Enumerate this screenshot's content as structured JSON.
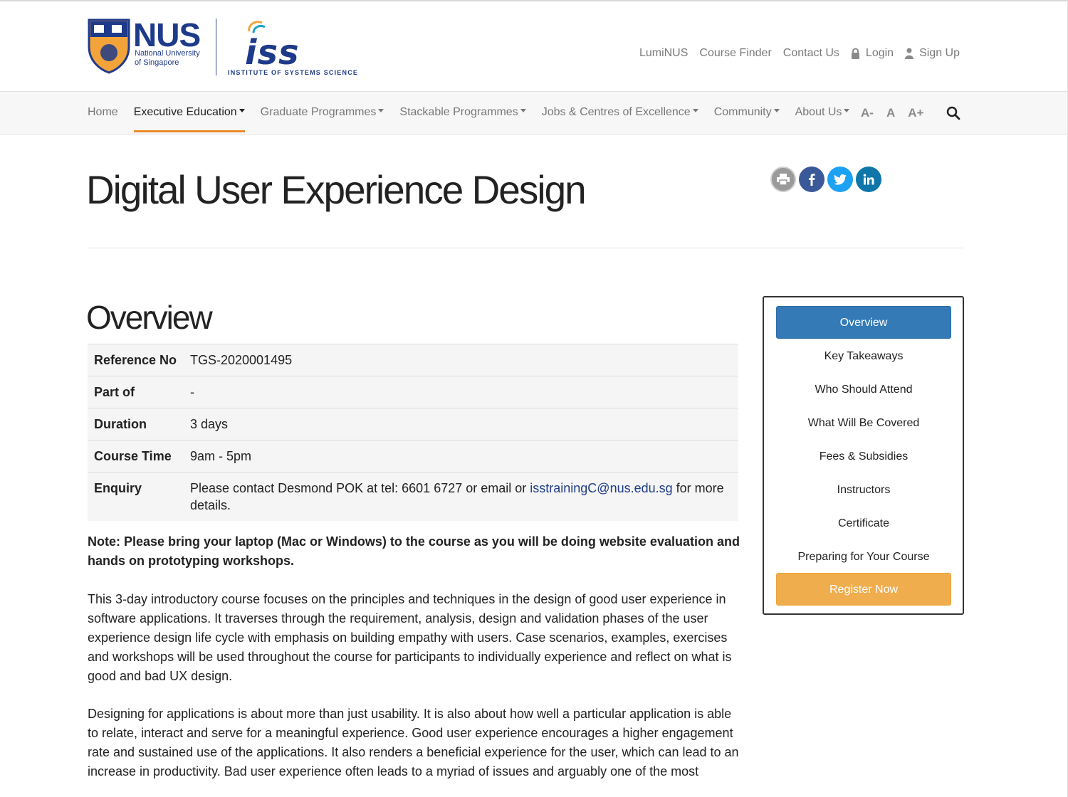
{
  "header": {
    "nus_logo_text": "NUS",
    "nus_logo_sub1": "National University",
    "nus_logo_sub2": "of Singapore",
    "iss_logo_text": "iss",
    "iss_logo_sub": "INSTITUTE OF SYSTEMS SCIENCE",
    "utility_links": [
      "LumiNUS",
      "Course Finder",
      "Contact Us"
    ],
    "login_label": "Login",
    "signup_label": "Sign Up"
  },
  "nav": {
    "items": [
      {
        "label": "Home",
        "dropdown": false
      },
      {
        "label": "Executive Education",
        "dropdown": true,
        "active": true
      },
      {
        "label": "Graduate Programmes",
        "dropdown": true
      },
      {
        "label": "Stackable Programmes",
        "dropdown": true
      },
      {
        "label": "Jobs & Centres of Excellence",
        "dropdown": true
      },
      {
        "label": "Community",
        "dropdown": true
      },
      {
        "label": "About Us",
        "dropdown": true
      }
    ],
    "font_sizes": [
      "A-",
      "A",
      "A+"
    ],
    "accent_color": "#e98b2b"
  },
  "page": {
    "title": "Digital User Experience Design"
  },
  "overview": {
    "heading": "Overview",
    "table": [
      {
        "key": "Reference No",
        "value": "TGS-2020001495"
      },
      {
        "key": "Part of",
        "value": "-"
      },
      {
        "key": "Duration",
        "value": "3 days"
      },
      {
        "key": "Course Time",
        "value": "9am - 5pm"
      }
    ],
    "enquiry_key": "Enquiry",
    "enquiry_prefix": "Please contact Desmond POK at tel: 6601 6727 or email or ",
    "enquiry_email": "isstrainingC@nus.edu.sg",
    "enquiry_suffix": " for more details.",
    "note": "Note: Please bring your laptop (Mac or Windows) to the course as you will be doing website evaluation and hands on prototyping workshops.",
    "paragraph1": "This 3-day introductory course focuses on the principles and techniques in the design of good user experience in software applications. It traverses through the requirement, analysis, design and validation phases of the user experience design life cycle with emphasis on building empathy with users. Case scenarios, examples, exercises and workshops will be used throughout the course for participants to individually experience and reflect on what is good and bad UX design.",
    "paragraph2": "Designing for applications is about more than just usability. It is also about how well a particular application is able to relate, interact and serve for a meaningful experience. Good user experience encourages a higher engagement rate and sustained use of the applications. It also renders a beneficial experience for the user, which can lead to an increase in productivity. Bad user experience often leads to a myriad of issues and arguably one of the most"
  },
  "sidenav": {
    "active": "Overview",
    "links": [
      "Key Takeaways",
      "Who Should Attend",
      "What Will Be Covered",
      "Fees & Subsidies",
      "Instructors",
      "Certificate",
      "Preparing for Your Course"
    ],
    "register": "Register Now",
    "primary_color": "#337ab7",
    "register_color": "#f0ad4e"
  },
  "share_icons": [
    "print-icon",
    "facebook-icon",
    "twitter-icon",
    "linkedin-icon"
  ]
}
